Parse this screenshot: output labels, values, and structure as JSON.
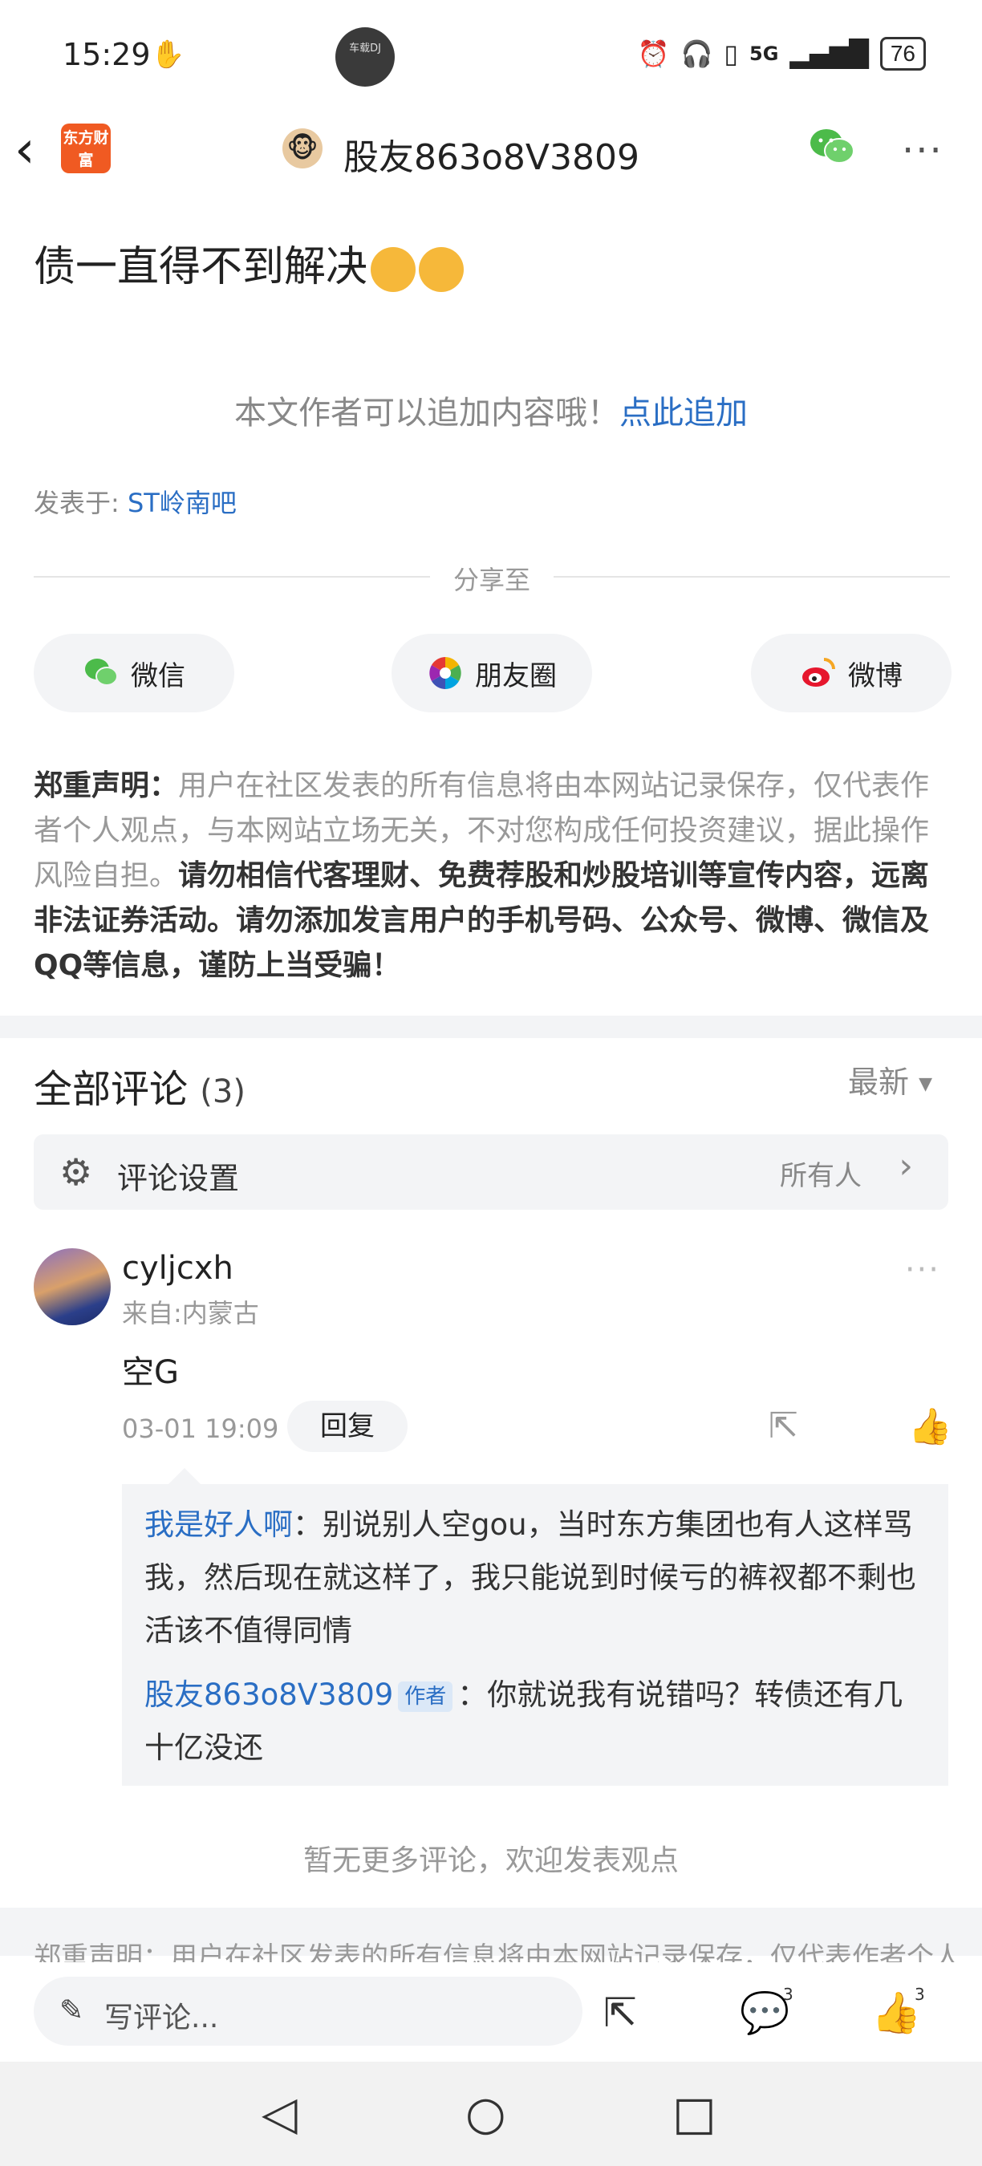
{
  "status_bar": {
    "time": "15:29",
    "camera_badge": "车载DJ",
    "network": "5G",
    "battery": "76"
  },
  "nav": {
    "logo_text": "东方财富",
    "title": "股友863o8V3809"
  },
  "post": {
    "headline": "债一直得不到解决",
    "append_prompt": "本文作者可以追加内容哦！",
    "append_link": "点此追加",
    "posted_prefix": "发表于: ",
    "posted_bar": "ST岭南吧"
  },
  "share": {
    "label": "分享至",
    "buttons": [
      {
        "label": "微信",
        "icon": "wechat-icon"
      },
      {
        "label": "朋友圈",
        "icon": "moments-icon"
      },
      {
        "label": "微博",
        "icon": "weibo-icon"
      }
    ]
  },
  "disclaimer": {
    "title": "郑重声明：",
    "body": "用户在社区发表的所有信息将由本网站记录保存，仅代表作者个人观点，与本网站立场无关，不对您构成任何投资建议，据此操作风险自担。",
    "warning": "请勿相信代客理财、免费荐股和炒股培训等宣传内容，远离非法证券活动。请勿添加发言用户的手机号码、公众号、微博、微信及QQ等信息，谨防上当受骗！"
  },
  "comments": {
    "title": "全部评论",
    "count": "(3)",
    "sort": "最新",
    "settings_label": "评论设置",
    "settings_value": "所有人",
    "items": [
      {
        "name": "cyljcxh",
        "from": "来自:内蒙古",
        "text": "空G",
        "date": "03-01 19:09",
        "reply_label": "回复",
        "replies": [
          {
            "name": "我是好人啊",
            "text": "：别说别人空gou，当时东方集团也有人这样骂我，然后现在就这样了，我只能说到时候亏的裤衩都不剩也活该不值得同情"
          },
          {
            "name": "股友863o8V3809",
            "badge": "作者",
            "text": "：你就说我有说错吗？转债还有几十亿没还"
          }
        ]
      }
    ],
    "no_more": "暂无更多评论，欢迎发表观点"
  },
  "footer_disclaimer": "郑重声明：用户在社区发表的所有信息将由本网站记录保存，仅代表作者个人",
  "bottom_bar": {
    "input_placeholder": "写评论...",
    "comment_count": "3",
    "like_count": "3"
  },
  "colors": {
    "link": "#2a6ec4",
    "brand": "#f05a22",
    "muted": "#999999"
  }
}
